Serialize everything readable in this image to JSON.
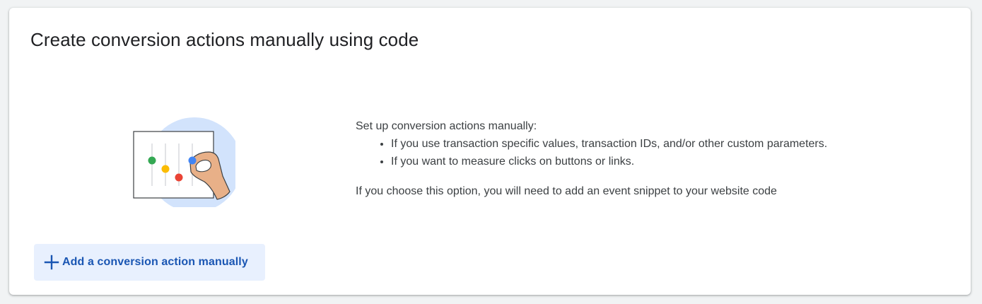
{
  "card": {
    "title": "Create conversion actions manually using code"
  },
  "illustration": {
    "icon": "sliders-with-hand-icon",
    "colors": {
      "circle_background": "#d2e3fc",
      "slider_green": "#34a853",
      "slider_yellow": "#fbbc04",
      "slider_red": "#ea4335",
      "slider_blue": "#4285f4",
      "hand_skin": "#e8b088"
    }
  },
  "description": {
    "intro": "Set up conversion actions manually:",
    "bullets": [
      "If you use transaction specific values, transaction IDs, and/or other custom parameters.",
      "If you want to measure clicks on buttons or links."
    ],
    "note": "If you choose this option, you will need to add an event snippet to your website code"
  },
  "add_button": {
    "label": "Add a conversion action manually",
    "icon": "plus-icon"
  },
  "colors": {
    "page_background": "#f1f3f4",
    "card_background": "#ffffff",
    "button_background": "#e8f0fe",
    "button_text": "#1a56b3",
    "title_text": "#202124",
    "body_text": "#3c4043"
  }
}
